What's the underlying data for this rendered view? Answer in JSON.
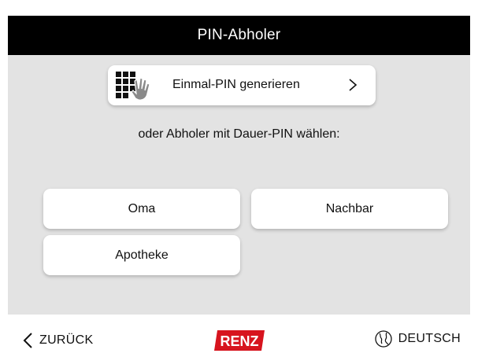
{
  "header": {
    "title": "PIN-Abholer"
  },
  "onetime": {
    "label": "Einmal-PIN generieren",
    "icon": "pin-keypad-hand-icon",
    "chevron": ">"
  },
  "prompt": "oder Abholer mit Dauer-PIN wählen:",
  "pickups": [
    {
      "label": "Oma"
    },
    {
      "label": "Nachbar"
    },
    {
      "label": "Apotheke"
    }
  ],
  "footer": {
    "back_label": "ZURÜCK",
    "logo_text": "RENZ",
    "language_label": "DEUTSCH"
  },
  "colors": {
    "header_bg": "#000000",
    "content_bg": "#e3e3e3",
    "brand_red": "#d7141e"
  }
}
